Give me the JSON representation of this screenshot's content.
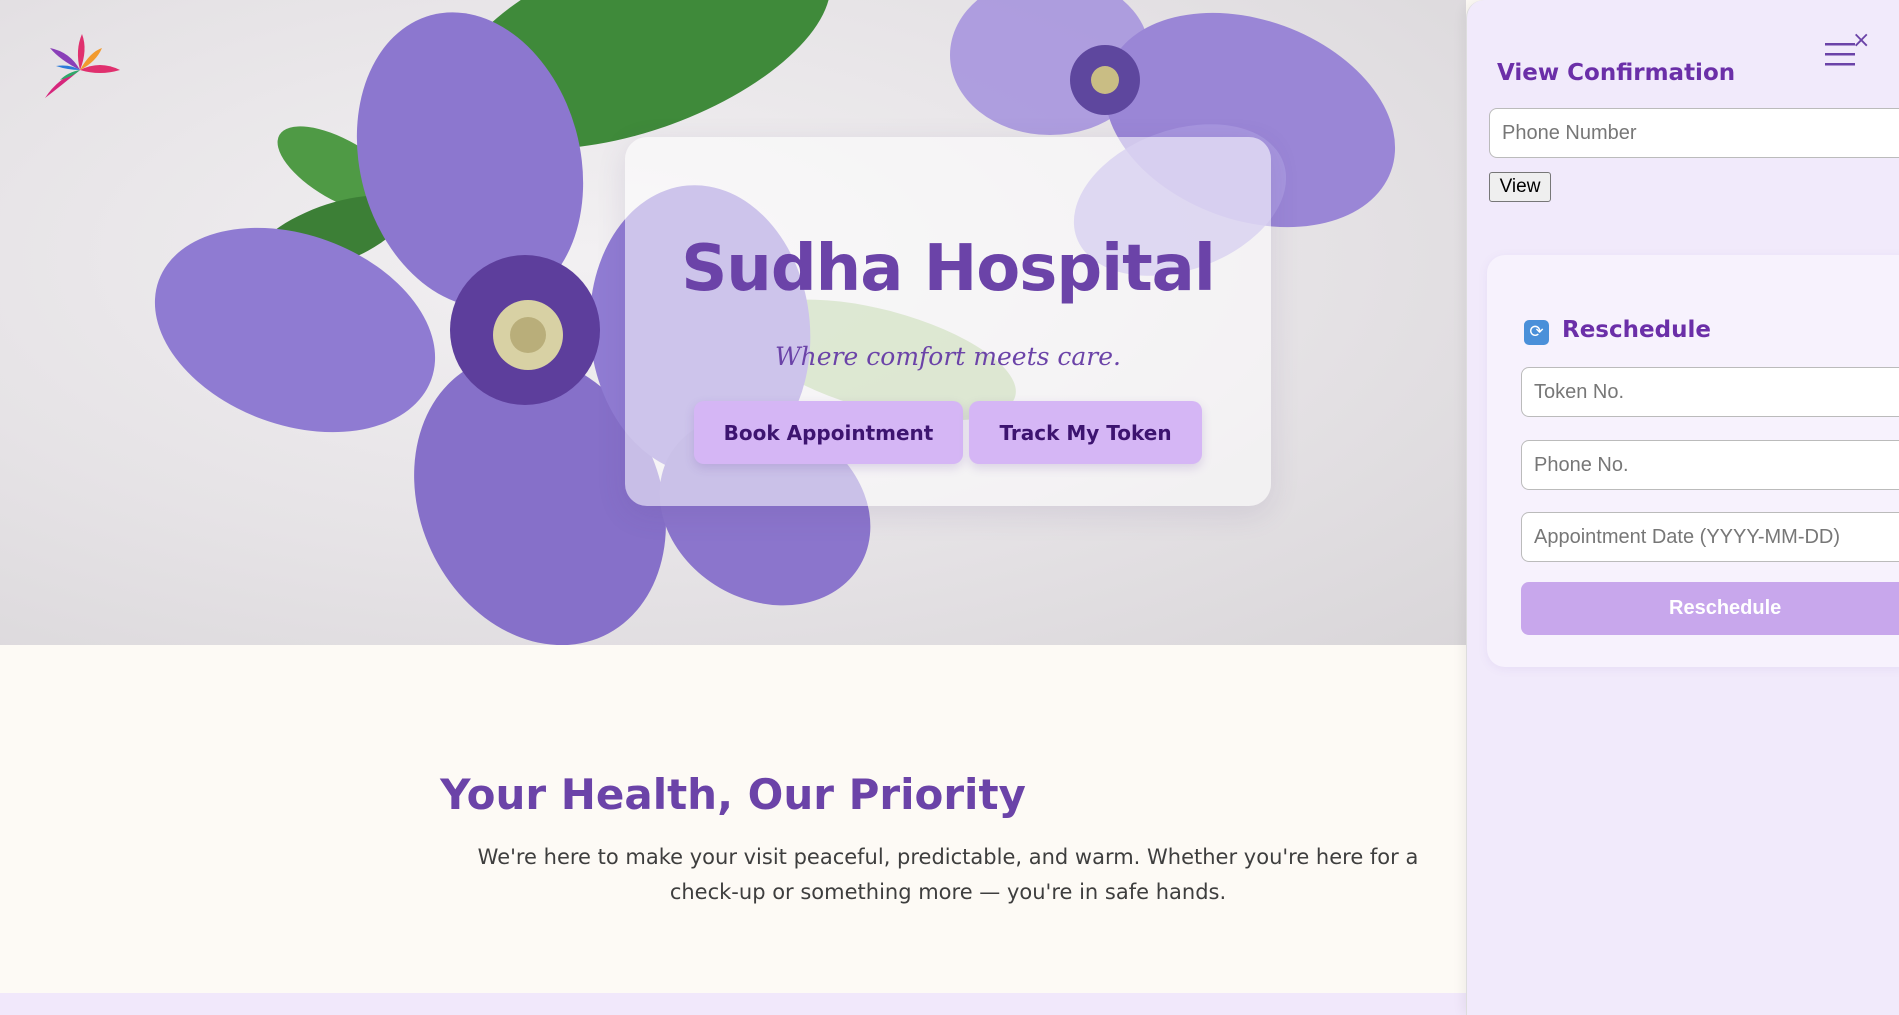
{
  "hero": {
    "title": "Sudha Hospital",
    "subtitle": "Where comfort meets care.",
    "buttons": {
      "book": "Book Appointment",
      "track": "Track My Token"
    }
  },
  "intro": {
    "title": "Your Health, Our Priority",
    "text": "We're here to make your visit peaceful, predictable, and warm. Whether you're here for a check-up or something more — you're in safe hands."
  },
  "sidebar": {
    "view_confirmation": {
      "title": "View Confirmation",
      "phone_placeholder": "Phone Number",
      "view_label": "View"
    },
    "reschedule": {
      "icon": "refresh-icon",
      "title": "Reschedule",
      "token_placeholder": "Token No.",
      "phone_placeholder": "Phone No.",
      "date_placeholder": "Appointment Date (YYYY-MM-DD)",
      "button_label": "Reschedule"
    },
    "close_symbol": "×"
  },
  "colors": {
    "primary": "#6b43a8",
    "button": "#d5b6f5",
    "sidebar_bg": "#f1eafb",
    "reschedule_button": "#c8a7ec"
  }
}
